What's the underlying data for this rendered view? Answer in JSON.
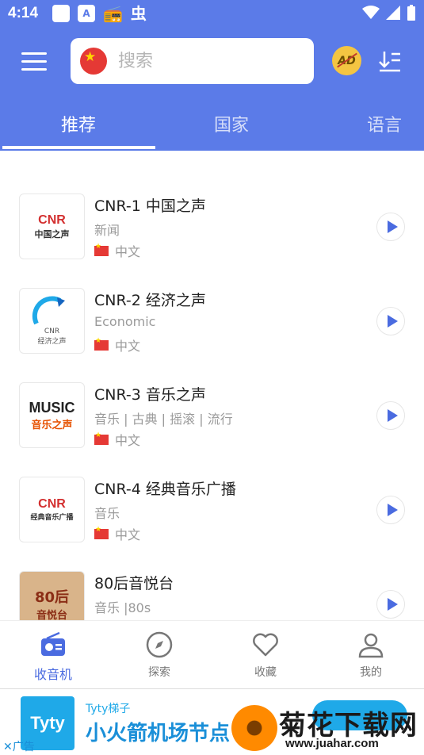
{
  "status_bar": {
    "time": "4:14"
  },
  "header": {
    "search_placeholder": "搜索",
    "ad_label": "AD"
  },
  "tabs": [
    {
      "label": "推荐",
      "active": true
    },
    {
      "label": "国家",
      "active": false
    },
    {
      "label": "语言",
      "active": false
    }
  ],
  "stations": [
    {
      "title": "CNR-1 中国之声",
      "subtitle": "新闻",
      "language": "中文",
      "logo_text": "CNR",
      "logo_caption": "中国之声"
    },
    {
      "title": "CNR-2 经济之声",
      "subtitle": "Economic",
      "language": "中文",
      "logo_text": "CNR",
      "logo_caption": "经济之声"
    },
    {
      "title": "CNR-3 音乐之声",
      "subtitle": "音乐 | 古典 | 摇滚 | 流行",
      "language": "中文",
      "logo_text": "MUSIC",
      "logo_caption": "音乐之声"
    },
    {
      "title": "CNR-4 经典音乐广播",
      "subtitle": "音乐",
      "language": "中文",
      "logo_text": "CNR",
      "logo_caption": "经典音乐广播"
    },
    {
      "title": "80后音悦台",
      "subtitle": "音乐 |80s",
      "language": "",
      "logo_text": "80后",
      "logo_caption": "音悦台"
    }
  ],
  "bottom_nav": [
    {
      "label": "收音机",
      "icon": "radio-icon",
      "active": true
    },
    {
      "label": "探索",
      "icon": "compass-icon",
      "active": false
    },
    {
      "label": "收藏",
      "icon": "heart-icon",
      "active": false
    },
    {
      "label": "我的",
      "icon": "person-icon",
      "active": false
    }
  ],
  "ad_banner": {
    "logo_text": "Tyty",
    "brand": "Tyty梯子",
    "headline": "小火箭机场节点",
    "tag": "✕广告"
  },
  "watermark": {
    "text": "菊花下载网",
    "url": "www.juahar.com"
  },
  "colors": {
    "primary": "#5b7be8",
    "accent": "#4a6be0"
  }
}
